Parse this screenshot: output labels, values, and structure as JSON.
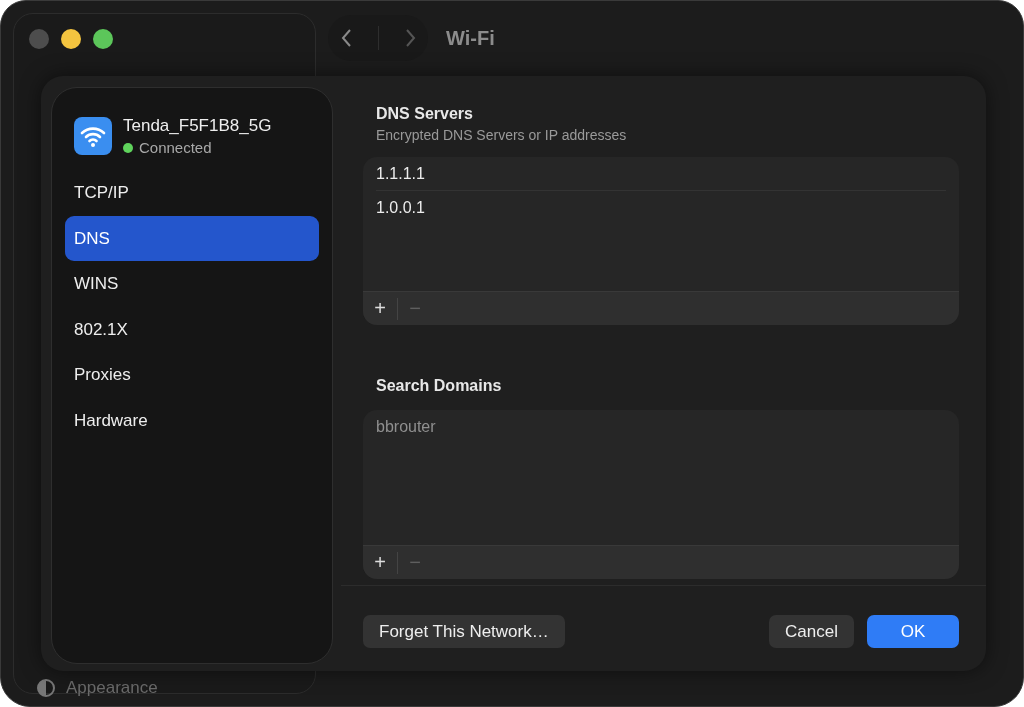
{
  "window": {
    "title": "Wi-Fi"
  },
  "background_sidebar": {
    "items": [
      {
        "label": "Appearance"
      }
    ]
  },
  "sheet": {
    "network": {
      "name": "Tenda_F5F1B8_5G",
      "status": "Connected",
      "connected": true
    },
    "nav": [
      {
        "label": "TCP/IP",
        "selected": false
      },
      {
        "label": "DNS",
        "selected": true
      },
      {
        "label": "WINS",
        "selected": false
      },
      {
        "label": "802.1X",
        "selected": false
      },
      {
        "label": "Proxies",
        "selected": false
      },
      {
        "label": "Hardware",
        "selected": false
      }
    ],
    "sections": [
      {
        "title": "DNS Servers",
        "subtitle": "Encrypted DNS Servers or IP addresses",
        "entries": [
          {
            "text": "1.1.1.1",
            "disabled": false
          },
          {
            "text": "1.0.0.1",
            "disabled": false
          }
        ],
        "add": {
          "label": "+",
          "disabled": false
        },
        "remove": {
          "label": "−",
          "disabled": true
        }
      },
      {
        "title": "Search Domains",
        "entries": [
          {
            "text": "bbrouter",
            "disabled": true
          }
        ],
        "add": {
          "label": "+",
          "disabled": false
        },
        "remove": {
          "label": "−",
          "disabled": true
        }
      }
    ],
    "buttons": [
      {
        "label": "Forget This Network…",
        "kind": "secondary"
      },
      {
        "label": "Cancel",
        "kind": "secondary"
      },
      {
        "label": "OK",
        "kind": "default"
      }
    ]
  }
}
